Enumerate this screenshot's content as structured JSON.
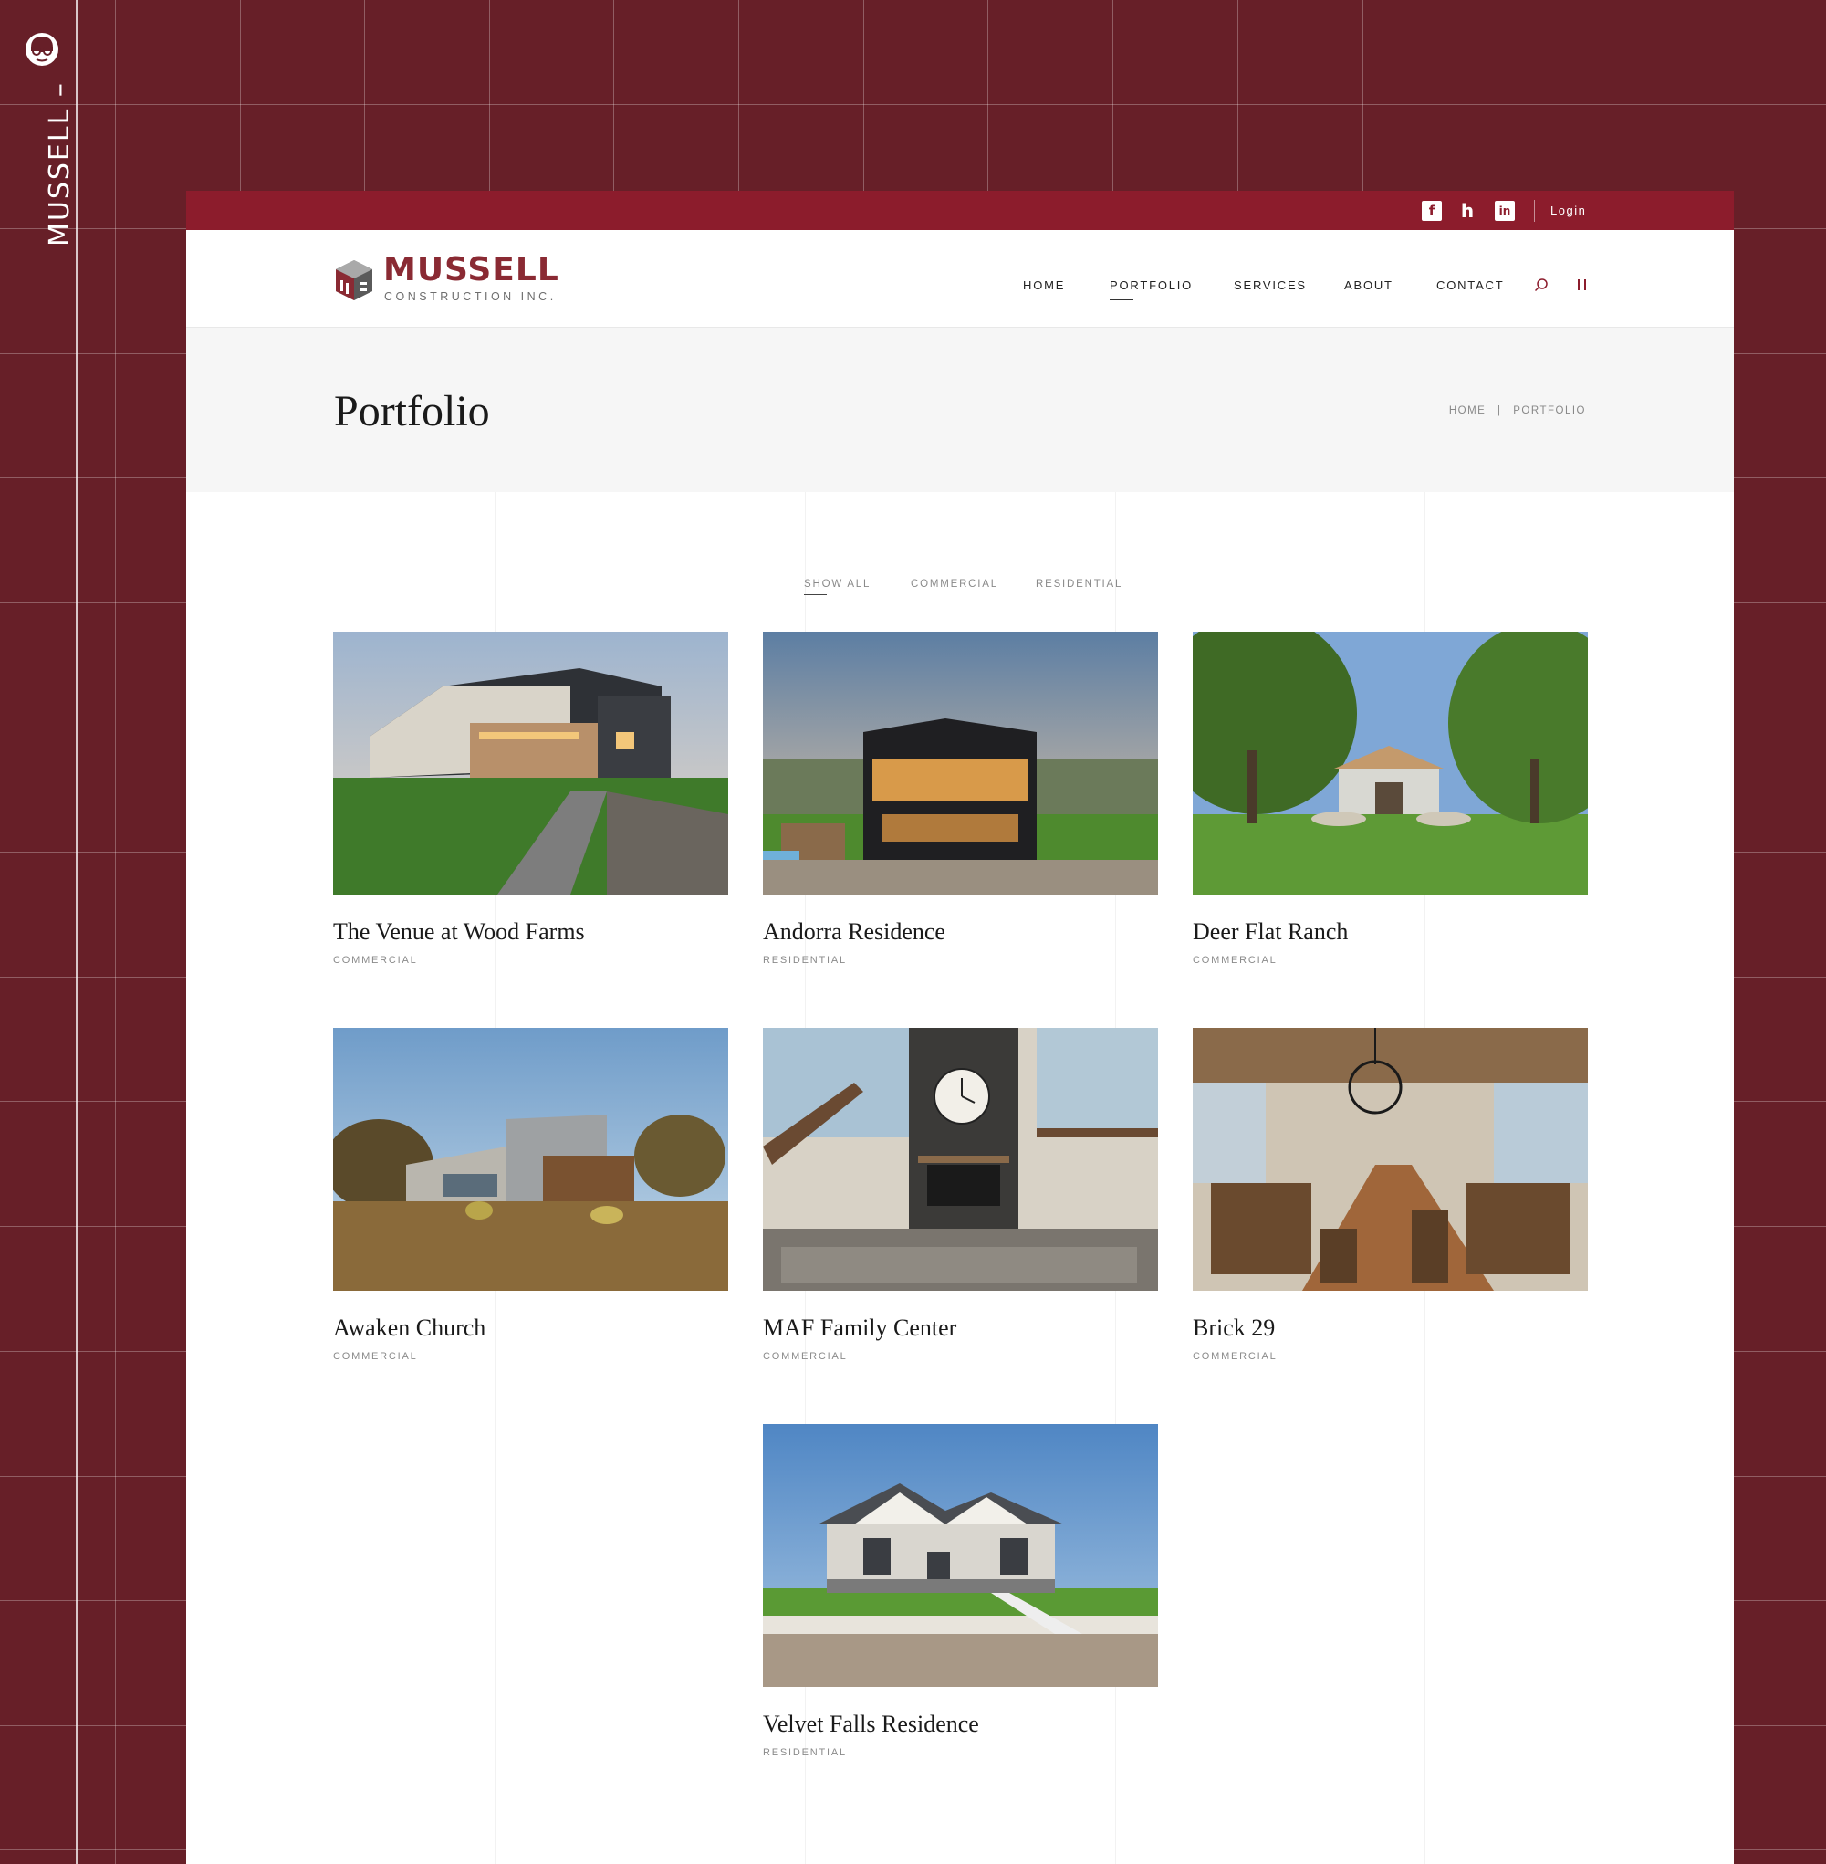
{
  "side": {
    "brand": "MUSSELL –"
  },
  "topbar": {
    "social": [
      {
        "name": "facebook",
        "glyph": "f"
      },
      {
        "name": "houzz",
        "glyph": "h"
      },
      {
        "name": "linkedin",
        "glyph": "in"
      }
    ],
    "login": "Login"
  },
  "header": {
    "logo_word": "MUSSELL",
    "logo_sub": "CONSTRUCTION INC.",
    "nav": [
      "HOME",
      "PORTFOLIO",
      "SERVICES",
      "ABOUT",
      "CONTACT"
    ],
    "active_nav": "PORTFOLIO"
  },
  "title_band": {
    "title": "Portfolio",
    "breadcrumb": [
      "HOME",
      "PORTFOLIO"
    ],
    "separator": "|"
  },
  "filters": [
    "SHOW ALL",
    "COMMERCIAL",
    "RESIDENTIAL"
  ],
  "active_filter": "SHOW ALL",
  "projects": [
    {
      "title": "The Venue at Wood Farms",
      "category": "COMMERCIAL"
    },
    {
      "title": "Andorra Residence",
      "category": "RESIDENTIAL"
    },
    {
      "title": "Deer Flat Ranch",
      "category": "COMMERCIAL"
    },
    {
      "title": "Awaken Church",
      "category": "COMMERCIAL"
    },
    {
      "title": "MAF Family Center",
      "category": "COMMERCIAL"
    },
    {
      "title": "Brick 29",
      "category": "COMMERCIAL"
    },
    {
      "title": "Velvet Falls Residence",
      "category": "RESIDENTIAL"
    }
  ],
  "colors": {
    "background": "#671f28",
    "topbar": "#8c1c2c",
    "brand": "#8a2a33"
  }
}
